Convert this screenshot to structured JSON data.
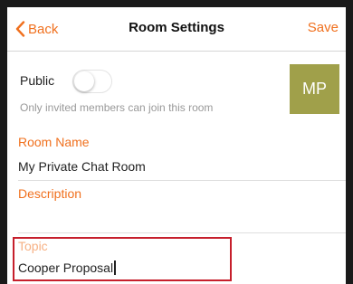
{
  "nav": {
    "back_label": "Back",
    "title": "Room Settings",
    "save_label": "Save"
  },
  "public": {
    "label": "Public",
    "enabled": false,
    "hint": "Only invited members can join this room"
  },
  "avatar": {
    "initials": "MP",
    "color": "#a0a04a"
  },
  "fields": {
    "room_name": {
      "label": "Room Name",
      "value": "My Private Chat Room"
    },
    "description": {
      "label": "Description",
      "value": ""
    },
    "topic": {
      "label": "Topic",
      "value": "Cooper Proposal"
    }
  },
  "colors": {
    "accent": "#f0701e",
    "highlight_box": "#c61f2c"
  },
  "icons": {
    "back": "chevron-left-icon"
  }
}
